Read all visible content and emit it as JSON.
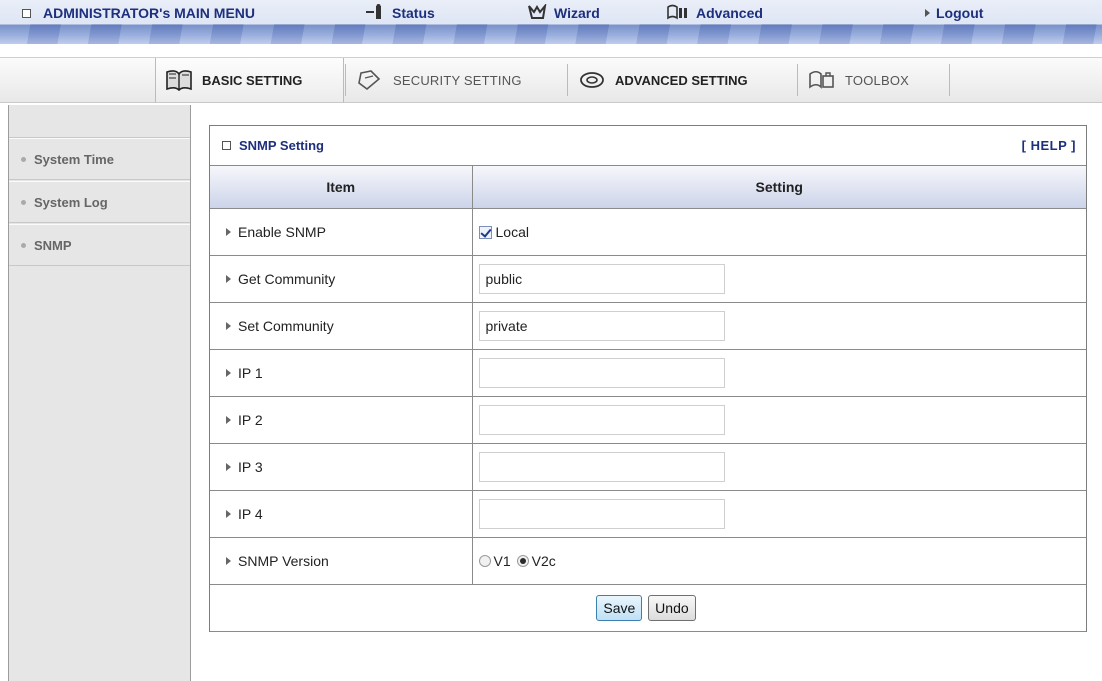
{
  "topnav": {
    "admin_menu": "ADMINISTRATOR's MAIN MENU",
    "status": "Status",
    "wizard": "Wizard",
    "advanced": "Advanced",
    "logout": "Logout"
  },
  "tabs": {
    "basic": "BASIC SETTING",
    "security": "SECURITY SETTING",
    "advanced": "ADVANCED SETTING",
    "toolbox": "TOOLBOX"
  },
  "sidebar": {
    "items": [
      {
        "label": "System Time"
      },
      {
        "label": "System Log"
      },
      {
        "label": "SNMP"
      }
    ]
  },
  "panel": {
    "title": "SNMP Setting",
    "help": "[ HELP ]",
    "col_item": "Item",
    "col_setting": "Setting"
  },
  "rows": {
    "enable_snmp": {
      "label": "Enable SNMP",
      "checkbox_label": "Local",
      "checked": true
    },
    "get_community": {
      "label": "Get Community",
      "value": "public"
    },
    "set_community": {
      "label": "Set Community",
      "value": "private"
    },
    "ip1": {
      "label": "IP 1",
      "value": ""
    },
    "ip2": {
      "label": "IP 2",
      "value": ""
    },
    "ip3": {
      "label": "IP 3",
      "value": ""
    },
    "ip4": {
      "label": "IP 4",
      "value": ""
    },
    "snmp_version": {
      "label": "SNMP Version",
      "v1": "V1",
      "v2c": "V2c",
      "selected": "V2c"
    }
  },
  "buttons": {
    "save": "Save",
    "undo": "Undo"
  },
  "colors": {
    "nav_text": "#1d2f7d",
    "header_blue": "#6c86c4",
    "sidebar_bg": "#e6e6e6",
    "border": "#8a8a8a"
  }
}
